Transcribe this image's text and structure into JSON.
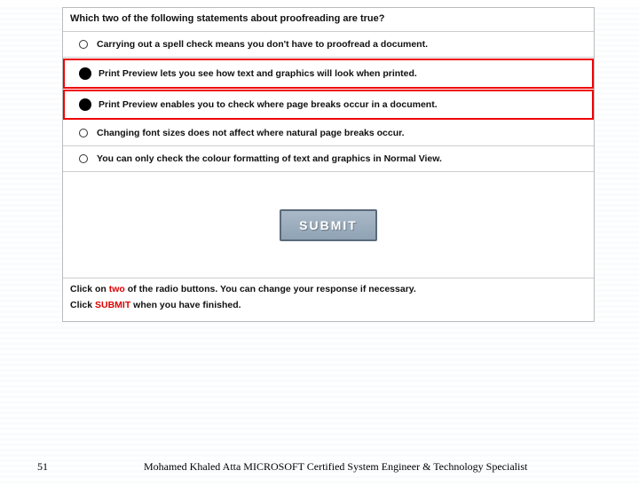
{
  "question": {
    "prefix": "Which ",
    "keyword": "two",
    "middle": " of the following statements about proofreading are ",
    "keyword2": "true",
    "suffix": "?"
  },
  "options": [
    {
      "text": "Carrying out a spell check means you don't have to proofread a document.",
      "selected": false,
      "highlight": false
    },
    {
      "text": "Print Preview lets you see how text and graphics will look when printed.",
      "selected": true,
      "highlight": true
    },
    {
      "text": "Print Preview enables you to check where page breaks occur in a document.",
      "selected": true,
      "highlight": true
    },
    {
      "text": "Changing font sizes does not affect where natural page breaks occur.",
      "selected": false,
      "highlight": false
    },
    {
      "text": "You can only check the colour formatting of text and graphics in Normal View.",
      "selected": false,
      "highlight": false
    }
  ],
  "submit_label": "SUBMIT",
  "instructions": {
    "line1_a": "Click on ",
    "line1_kw": "two",
    "line1_b": " of the radio buttons. You can change your response if necessary.",
    "line2_a": "Click ",
    "line2_kw": "SUBMIT",
    "line2_b": " when you have finished."
  },
  "footer": {
    "page_number": "51",
    "credit": "Mohamed Khaled Atta MICROSOFT Certified System Engineer & Technology Specialist"
  }
}
